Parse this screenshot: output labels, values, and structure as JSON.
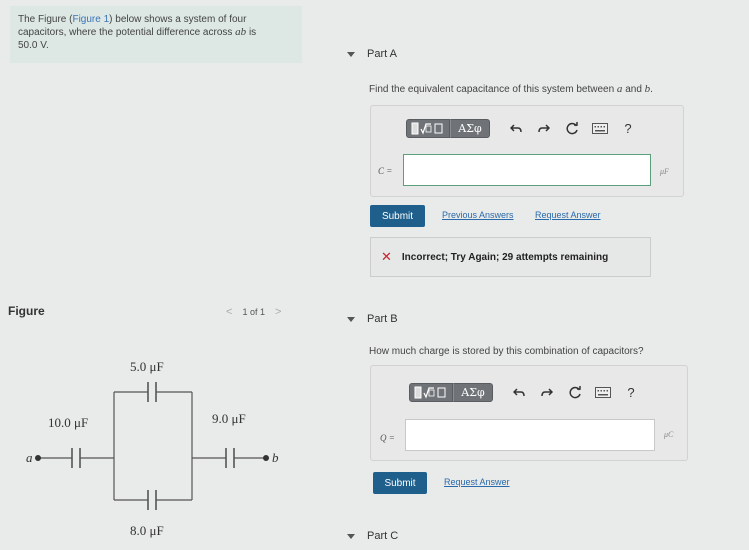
{
  "intro": {
    "before_link": "The Figure (",
    "link": "Figure 1",
    "after_link": ") below shows a system of four capacitors, where the potential difference across ",
    "var": "ab",
    "is": " is",
    "value": "50.0",
    "unit": "V",
    "period": "."
  },
  "partA": {
    "label": "Part A",
    "question_pre": "Find the equivalent capacitance of this system between ",
    "var_a": "a",
    "and": " and ",
    "var_b": "b",
    "period": ".",
    "eq_label": "C =",
    "unit": "μF",
    "submit": "Submit",
    "link_prev": "Previous Answers",
    "link_request": "Request Answer"
  },
  "feedback": {
    "text": "Incorrect; Try Again; 29 attempts remaining"
  },
  "toolbar": {
    "greek": "ΑΣφ",
    "help": "?"
  },
  "figure": {
    "label": "Figure",
    "page": "1 of 1",
    "caps": {
      "top": "5.0 μF",
      "left": "10.0 μF",
      "right": "9.0 μF",
      "bottom": "8.0 μF"
    },
    "node_a": "a",
    "node_b": "b"
  },
  "partB": {
    "label": "Part B",
    "question": "How much charge is stored by this combination of capacitors?",
    "eq_label": "Q =",
    "unit": "μC",
    "submit": "Submit",
    "link_request": "Request Answer"
  },
  "partC": {
    "label": "Part C"
  }
}
